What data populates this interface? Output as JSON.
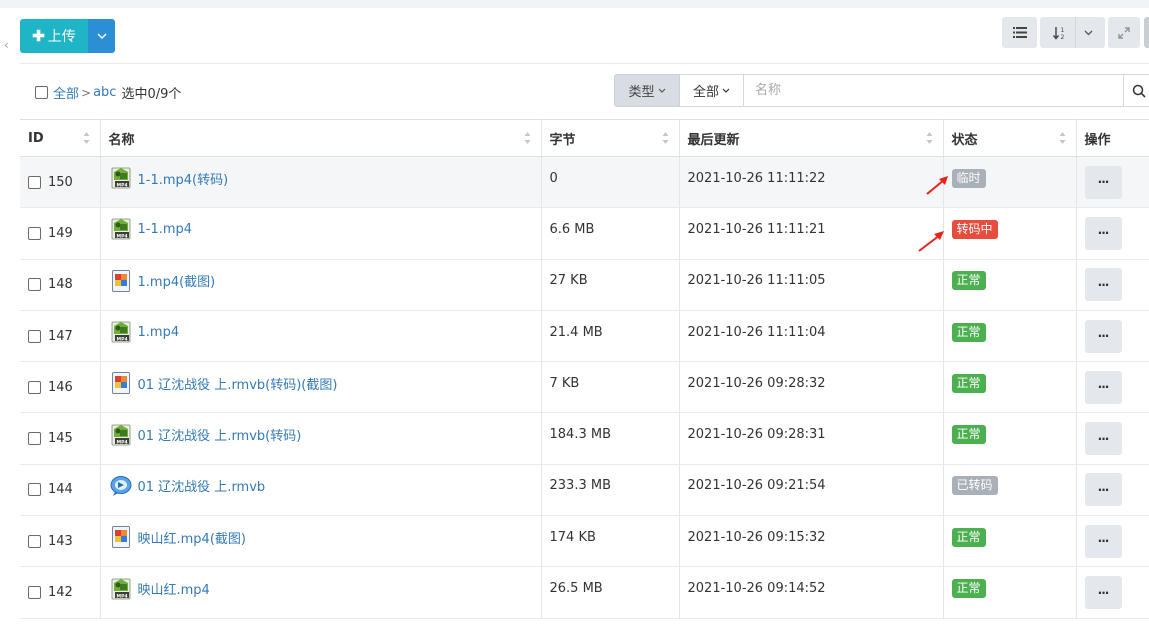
{
  "toolbar": {
    "upload_label": "上传"
  },
  "breadcrumb": {
    "root": "全部",
    "separator": ">",
    "folder": "abc",
    "selection": "选中0/9个"
  },
  "filter": {
    "type_label": "类型",
    "scope_label": "全部",
    "search_placeholder": "名称"
  },
  "table": {
    "headers": [
      "ID",
      "名称",
      "字节",
      "最后更新",
      "状态",
      "操作"
    ],
    "op_label": "···",
    "rows": [
      {
        "id": "150",
        "name": "1-1.mp4(转码)",
        "icon": "video-icon",
        "size": "0",
        "updated": "2021-10-26 11:11:22",
        "status": "临时",
        "status_color": "gray"
      },
      {
        "id": "149",
        "name": "1-1.mp4",
        "icon": "video-icon",
        "size": "6.6 MB",
        "updated": "2021-10-26 11:11:21",
        "status": "转码中",
        "status_color": "red"
      },
      {
        "id": "148",
        "name": "1.mp4(截图)",
        "icon": "image-icon",
        "size": "27 KB",
        "updated": "2021-10-26 11:11:05",
        "status": "正常",
        "status_color": "green"
      },
      {
        "id": "147",
        "name": "1.mp4",
        "icon": "video-icon",
        "size": "21.4 MB",
        "updated": "2021-10-26 11:11:04",
        "status": "正常",
        "status_color": "green"
      },
      {
        "id": "146",
        "name": "01 辽沈战役 上.rmvb(转码)(截图)",
        "icon": "image-icon",
        "size": "7 KB",
        "updated": "2021-10-26 09:28:32",
        "status": "正常",
        "status_color": "green"
      },
      {
        "id": "145",
        "name": "01 辽沈战役 上.rmvb(转码)",
        "icon": "video-icon",
        "size": "184.3 MB",
        "updated": "2021-10-26 09:28:31",
        "status": "正常",
        "status_color": "green"
      },
      {
        "id": "144",
        "name": "01 辽沈战役 上.rmvb",
        "icon": "realplayer-icon",
        "size": "233.3 MB",
        "updated": "2021-10-26 09:21:54",
        "status": "已转码",
        "status_color": "gray"
      },
      {
        "id": "143",
        "name": "映山红.mp4(截图)",
        "icon": "image-icon",
        "size": "174 KB",
        "updated": "2021-10-26 09:15:32",
        "status": "正常",
        "status_color": "green"
      },
      {
        "id": "142",
        "name": "映山红.mp4",
        "icon": "video-icon",
        "size": "26.5 MB",
        "updated": "2021-10-26 09:14:52",
        "status": "正常",
        "status_color": "green"
      }
    ]
  },
  "colors": {
    "upload": "#1fb5c7",
    "upload_dropdown": "#2b8fd6",
    "link": "#337ab7",
    "status_gray": "#aab0b8",
    "status_red": "#e74c3c",
    "status_green": "#4cb050",
    "annotation_arrow": "#e8231b"
  }
}
